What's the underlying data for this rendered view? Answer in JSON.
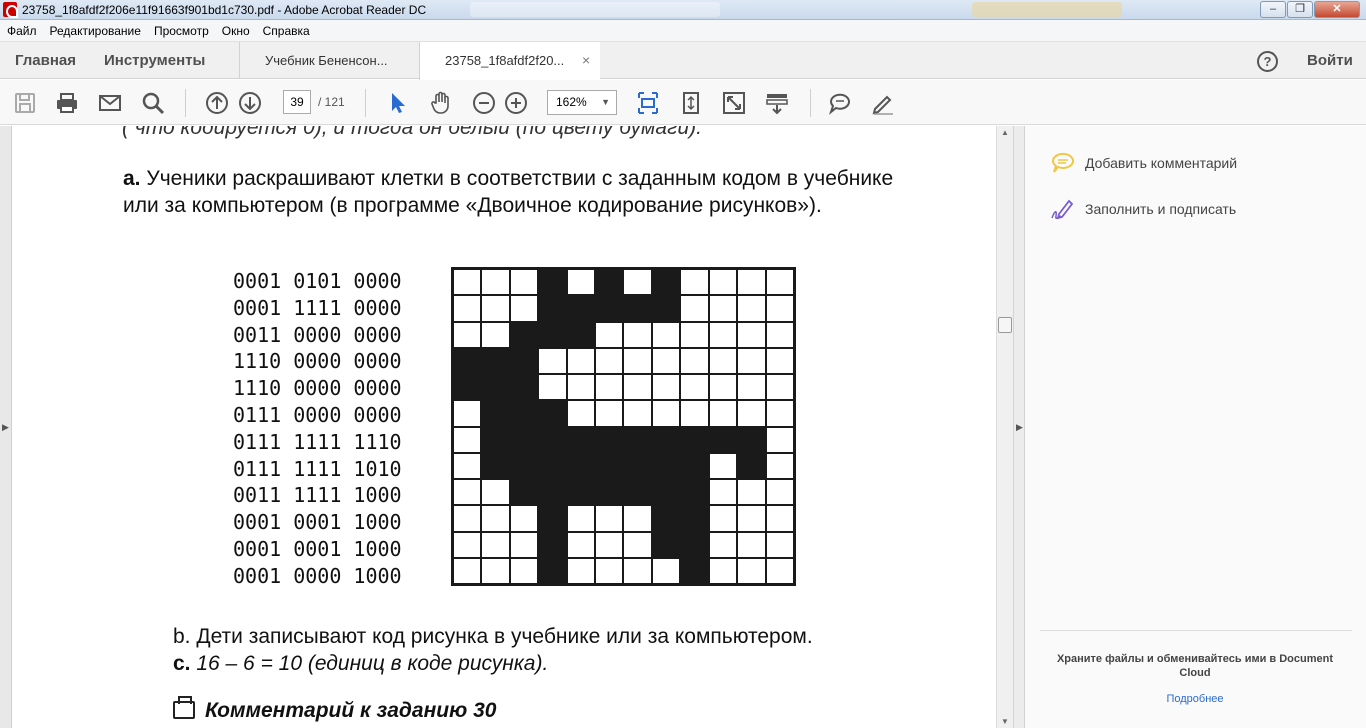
{
  "window": {
    "title": "23758_1f8afdf2f206e11f91663f901bd1c730.pdf - Adobe Acrobat Reader DC",
    "min_glyph": "–",
    "max_glyph": "❐",
    "close_glyph": "✕"
  },
  "menu": [
    "Файл",
    "Редактирование",
    "Просмотр",
    "Окно",
    "Справка"
  ],
  "tabs": {
    "home": "Главная",
    "tools": "Инструменты",
    "doc1": "Учебник Бененсон...",
    "doc2": "23758_1f8afdf2f20...",
    "close_glyph": "×"
  },
  "header_right": {
    "help_glyph": "?",
    "login": "Войти"
  },
  "toolbar": {
    "page_current": "39",
    "page_total": "/ 121",
    "zoom": "162%",
    "zoom_arrow": "▼"
  },
  "document": {
    "clipped_line": "( что кодируется 0), и тогда он белый (по цвету бумаги).",
    "para_a_label": "a.",
    "para_a_text": " Ученики раскрашивают клетки в соответствии с заданным кодом в учебнике или за компьютером (в программе «Двоичное кодирование рисунков»).",
    "codes": [
      "0001 0101 0000",
      "0001 1111 0000",
      "0011 0000 0000",
      "1110 0000 0000",
      "1110 0000 0000",
      "0111 0000 0000",
      "0111 1111 1110",
      "0111 1111 1010",
      "0011 1111 1000",
      "0001 0001 1000",
      "0001 0001 1000",
      "0001 0000 1000"
    ],
    "grid": [
      "000101010000",
      "000111110000",
      "001110000000",
      "111000000000",
      "111000000000",
      "011100000000",
      "011111111110",
      "011111111010",
      "001111111000",
      "000100011000",
      "000100011000",
      "000100001000"
    ],
    "para_b": "b. Дети записывают код рисунка в учебнике или за компьютером.",
    "para_c_label": "c.",
    "para_c_text": " 16 – 6 = 10 (единиц в коде рисунка).",
    "comment_heading": "Комментарий к заданию 30"
  },
  "right_panel": {
    "add_comment": "Добавить комментарий",
    "fill_sign": "Заполнить и подписать",
    "cloud_text": "Храните файлы и обменивайтесь ими в Document Cloud",
    "cloud_link": "Подробнее"
  },
  "scroll": {
    "up": "▲",
    "down": "▼"
  },
  "panel_arrows": {
    "left": "▶",
    "right": "▶"
  },
  "colors": {
    "accent": "#2a6bd1",
    "comment_icon": "#f2c744",
    "sign_icon": "#7a5cd0"
  }
}
